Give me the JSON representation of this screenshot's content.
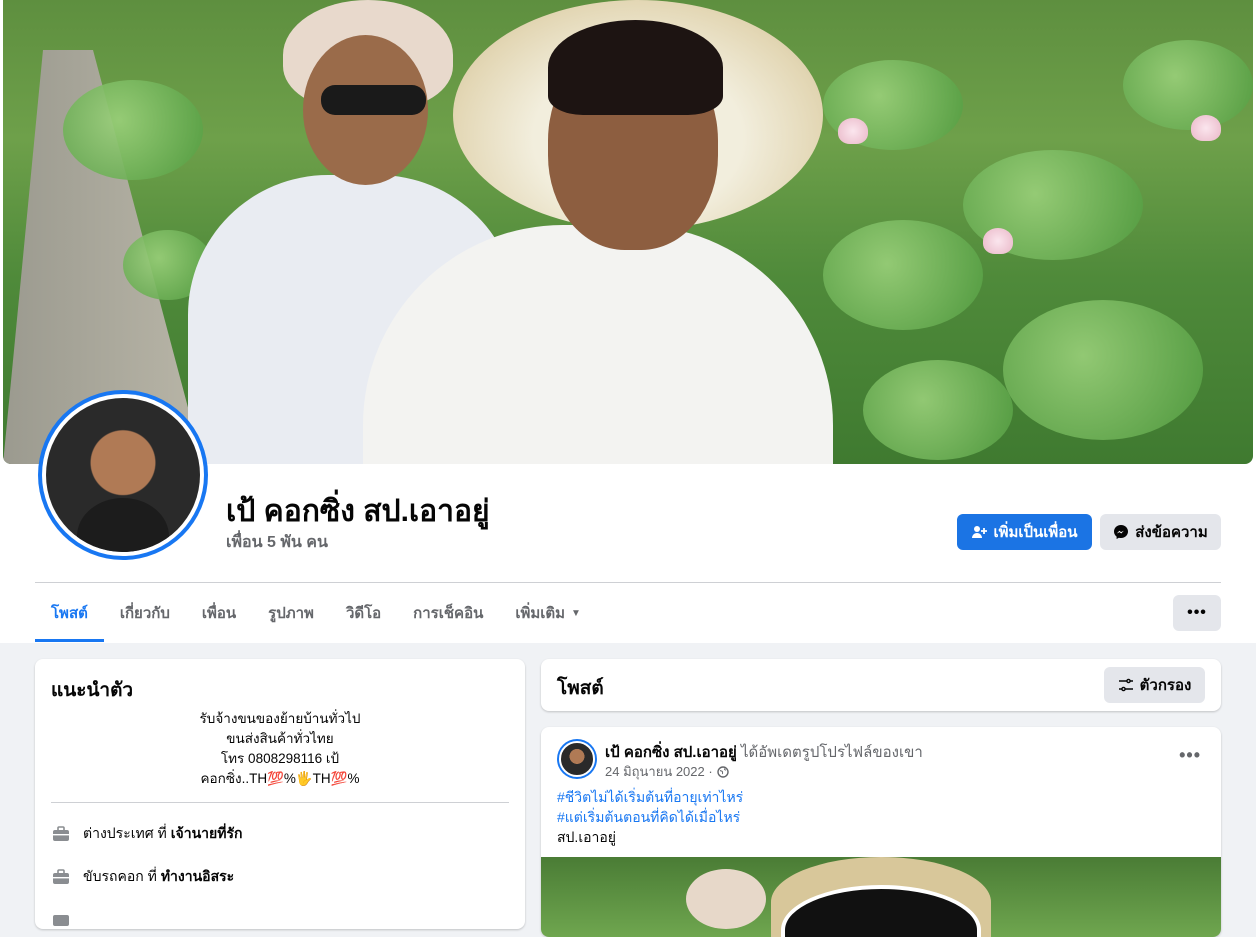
{
  "profile": {
    "name": "เป้ คอกซิ่ง สป.เอาอยู่",
    "friends": "เพื่อน 5 พัน คน"
  },
  "actions": {
    "add_friend": "เพิ่มเป็นเพื่อน",
    "message": "ส่งข้อความ"
  },
  "tabs": [
    {
      "label": "โพสต์",
      "active": true
    },
    {
      "label": "เกี่ยวกับ"
    },
    {
      "label": "เพื่อน"
    },
    {
      "label": "รูปภาพ"
    },
    {
      "label": "วิดีโอ"
    },
    {
      "label": "การเช็คอิน"
    },
    {
      "label": "เพิ่มเติม"
    }
  ],
  "intro": {
    "title": "แนะนำตัว",
    "bio": [
      "รับจ้างขนของย้ายบ้านทั่วไป",
      "ขนส่งสินค้าทั่วไทย",
      "โทร 0808298116 เป้",
      "คอกซิ่ง..TH💯%🖐TH💯%"
    ],
    "items": [
      {
        "prefix": "ต่างประเทศ ที่",
        "bold": "เจ้านายที่รัก"
      },
      {
        "prefix": "ขับรถคอก ที่",
        "bold": "ทำงานอิสระ"
      }
    ]
  },
  "posts_section": {
    "title": "โพสต์",
    "filter_label": "ตัวกรอง"
  },
  "post": {
    "author": "เป้ คอกซิ่ง สป.เอาอยู่",
    "action": "ได้อัพเดตรูปโปรไฟล์ของเขา",
    "date": "24 มิถุนายน 2022 ·",
    "hashtags": [
      "#ชีวิตไม่ได้เริ่มต้นที่อายุเท่าไหร่",
      "#แต่เริ่มต้นตอนที่คิดได้เมื่อไหร่"
    ],
    "text": "สป.เอาอยู่"
  },
  "colors": {
    "accent": "#1877f2",
    "button_grey": "#e4e6eb",
    "page_bg": "#f0f2f5"
  }
}
